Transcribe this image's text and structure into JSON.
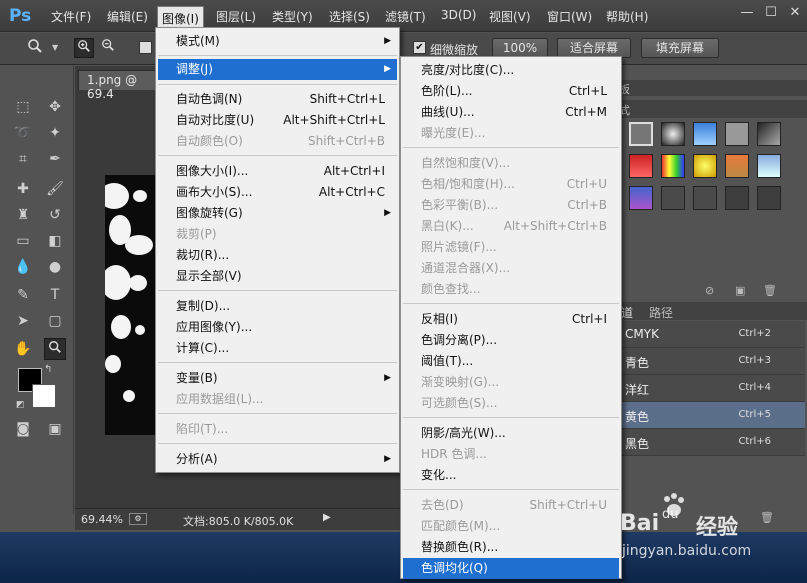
{
  "app": {
    "logo": "Ps"
  },
  "menubar": {
    "items": [
      "文件(F)",
      "编辑(E)",
      "图像(I)",
      "图层(L)",
      "类型(Y)",
      "选择(S)",
      "滤镜(T)",
      "3D(D)",
      "视图(V)",
      "窗口(W)",
      "帮助(H)"
    ],
    "active_index": 2,
    "window_controls": [
      "—",
      "☐",
      "✕"
    ]
  },
  "options": {
    "scrubby_zoom_label": "细微缩放",
    "scrubby_zoom_checked": true,
    "zoom_value": "100%",
    "fit_screen": "适合屏幕",
    "fill_screen": "填充屏幕"
  },
  "document": {
    "tab_title": "1.png @ 69.4",
    "zoom": "69.44%",
    "doc_info": "文档:805.0 K/805.0K"
  },
  "panels": {
    "header_fragment_1": "板",
    "header_fragment_2": "式",
    "channels_tab": "道",
    "paths_tab": "路径",
    "channels": [
      {
        "name": "CMYK",
        "key": "Ctrl+2",
        "selected": false
      },
      {
        "name": "青色",
        "key": "Ctrl+3",
        "selected": false
      },
      {
        "name": "洋红",
        "key": "Ctrl+4",
        "selected": false
      },
      {
        "name": "黄色",
        "key": "Ctrl+5",
        "selected": true
      },
      {
        "name": "黑色",
        "key": "Ctrl+6",
        "selected": false
      }
    ]
  },
  "image_menu": {
    "items": [
      {
        "label": "模式(M)",
        "submenu": true
      },
      {
        "label": "调整(J)",
        "submenu": true,
        "highlighted": true
      },
      {
        "label": "自动色调(N)",
        "key": "Shift+Ctrl+L"
      },
      {
        "label": "自动对比度(U)",
        "key": "Alt+Shift+Ctrl+L"
      },
      {
        "label": "自动颜色(O)",
        "key": "Shift+Ctrl+B",
        "disabled": true
      },
      {
        "label": "图像大小(I)...",
        "key": "Alt+Ctrl+I"
      },
      {
        "label": "画布大小(S)...",
        "key": "Alt+Ctrl+C"
      },
      {
        "label": "图像旋转(G)",
        "submenu": true
      },
      {
        "label": "裁剪(P)",
        "disabled": true
      },
      {
        "label": "裁切(R)..."
      },
      {
        "label": "显示全部(V)"
      },
      {
        "label": "复制(D)..."
      },
      {
        "label": "应用图像(Y)..."
      },
      {
        "label": "计算(C)..."
      },
      {
        "label": "变量(B)",
        "submenu": true
      },
      {
        "label": "应用数据组(L)...",
        "disabled": true
      },
      {
        "label": "陷印(T)...",
        "disabled": true
      },
      {
        "label": "分析(A)",
        "submenu": true
      }
    ]
  },
  "adjust_menu": {
    "items": [
      {
        "label": "亮度/对比度(C)..."
      },
      {
        "label": "色阶(L)...",
        "key": "Ctrl+L"
      },
      {
        "label": "曲线(U)...",
        "key": "Ctrl+M"
      },
      {
        "label": "曝光度(E)...",
        "disabled": true
      },
      {
        "label": "自然饱和度(V)...",
        "disabled": true
      },
      {
        "label": "色相/饱和度(H)...",
        "key": "Ctrl+U",
        "disabled": true
      },
      {
        "label": "色彩平衡(B)...",
        "key": "Ctrl+B",
        "disabled": true
      },
      {
        "label": "黑白(K)...",
        "key": "Alt+Shift+Ctrl+B",
        "disabled": true
      },
      {
        "label": "照片滤镜(F)...",
        "disabled": true
      },
      {
        "label": "通道混合器(X)...",
        "disabled": true
      },
      {
        "label": "颜色查找...",
        "disabled": true
      },
      {
        "label": "反相(I)",
        "key": "Ctrl+I"
      },
      {
        "label": "色调分离(P)..."
      },
      {
        "label": "阈值(T)..."
      },
      {
        "label": "渐变映射(G)...",
        "disabled": true
      },
      {
        "label": "可选颜色(S)...",
        "disabled": true
      },
      {
        "label": "阴影/高光(W)..."
      },
      {
        "label": "HDR 色调...",
        "disabled": true
      },
      {
        "label": "变化..."
      },
      {
        "label": "去色(D)",
        "key": "Shift+Ctrl+U",
        "disabled": true
      },
      {
        "label": "匹配颜色(M)...",
        "disabled": true
      },
      {
        "label": "替换颜色(R)..."
      },
      {
        "label": "色调均化(Q)",
        "highlighted": true
      }
    ]
  },
  "watermark": {
    "brand_a": "Bai",
    "brand_b": "经验",
    "url": "jingyan.baidu.com"
  }
}
